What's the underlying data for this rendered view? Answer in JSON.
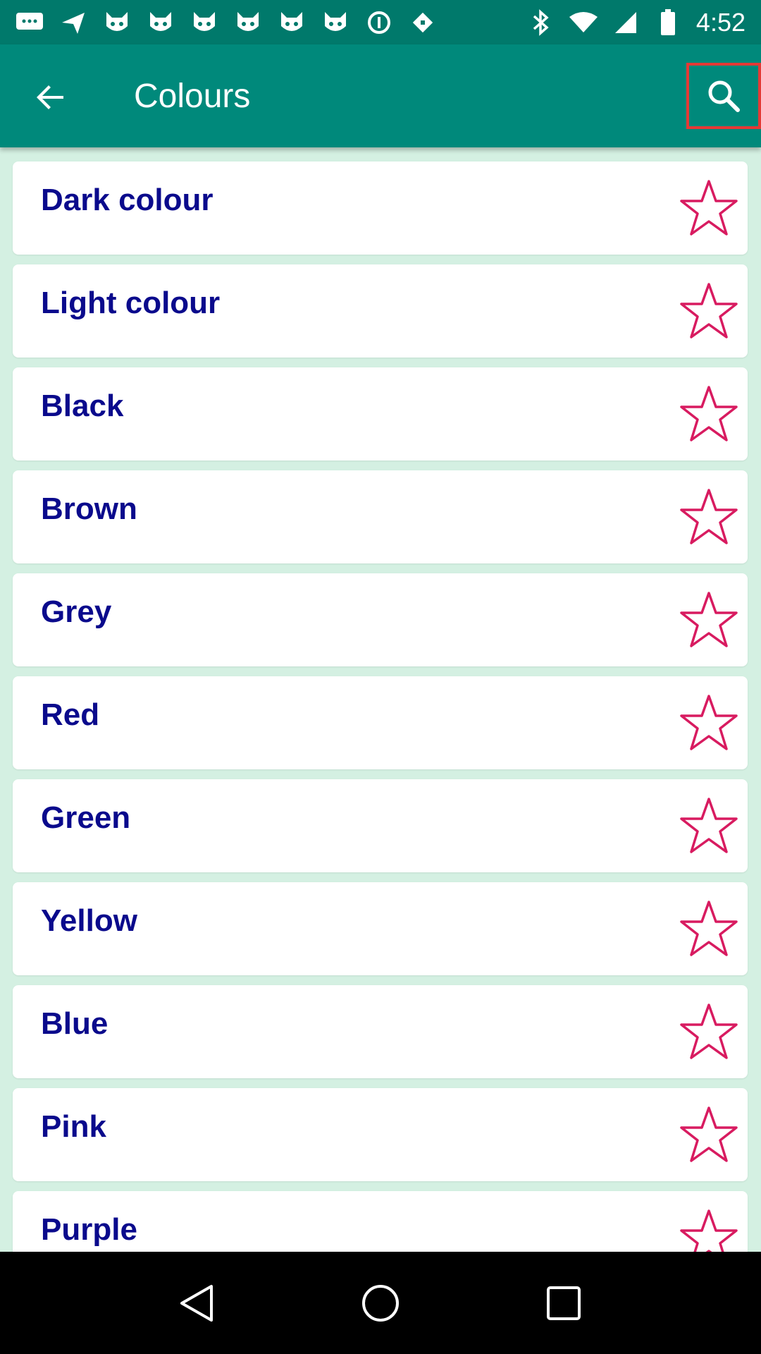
{
  "status_bar": {
    "time": "4:52",
    "icons": [
      "messaging-icon",
      "send-icon",
      "cat-icon",
      "cat-icon",
      "cat-icon",
      "cat-icon",
      "cat-icon",
      "cat-icon",
      "data-saver-icon",
      "fake-gps-icon",
      "bluetooth-icon",
      "wifi-icon",
      "signal-icon",
      "battery-icon"
    ]
  },
  "app_bar": {
    "title": "Colours",
    "back_icon": "arrow-back-icon",
    "search_icon": "search-icon"
  },
  "colors": {
    "app_bar": "#00897b",
    "status_bar": "#00796b",
    "background": "#d4f0e2",
    "item_text": "#0a0a8c",
    "star": "#d81b60",
    "highlight": "#e53935"
  },
  "items": [
    {
      "label": "Dark colour",
      "favorite": false
    },
    {
      "label": "Light colour",
      "favorite": false
    },
    {
      "label": "Black",
      "favorite": false
    },
    {
      "label": "Brown",
      "favorite": false
    },
    {
      "label": "Grey",
      "favorite": false
    },
    {
      "label": "Red",
      "favorite": false
    },
    {
      "label": "Green",
      "favorite": false
    },
    {
      "label": "Yellow",
      "favorite": false
    },
    {
      "label": "Blue",
      "favorite": false
    },
    {
      "label": "Pink",
      "favorite": false
    },
    {
      "label": "Purple",
      "favorite": false
    }
  ],
  "nav_bar": {
    "icons": [
      "back-triangle-icon",
      "home-circle-icon",
      "recents-square-icon"
    ]
  }
}
